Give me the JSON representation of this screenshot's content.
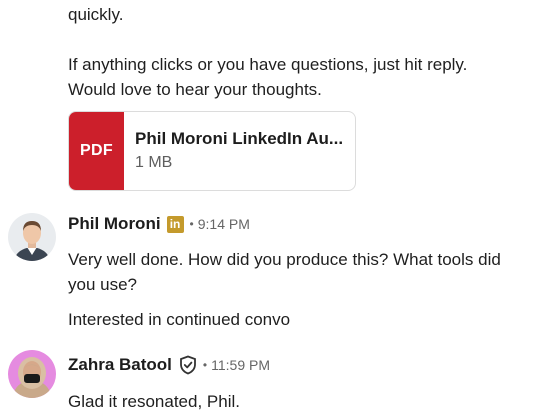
{
  "thread": {
    "prev_message": {
      "line_quickly": "quickly.",
      "line_reply_1": "If anything clicks or you have questions, just hit reply.",
      "line_reply_2": "Would love to hear your thoughts.",
      "attachment": {
        "type_label": "PDF",
        "file_name": "Phil Moroni LinkedIn Au...",
        "file_size": "1 MB"
      }
    },
    "messages": [
      {
        "sender": "Phil Moroni",
        "badge_icon": "linkedin-premium-icon",
        "separator": "•",
        "time": "9:14 PM",
        "lines": [
          "Very well done. How did you produce this? What tools did",
          "you use?",
          "Interested in continued convo"
        ]
      },
      {
        "sender": "Zahra Batool",
        "badge_icon": "verified-shield-icon",
        "separator": "•",
        "time": "11:59 PM",
        "lines": [
          "Glad it resonated, Phil."
        ]
      }
    ]
  },
  "colors": {
    "pdf_red": "#cc1f2b",
    "premium_gold": "#c49a2c",
    "text": "#1d1d1d",
    "meta_gray": "#666666"
  }
}
